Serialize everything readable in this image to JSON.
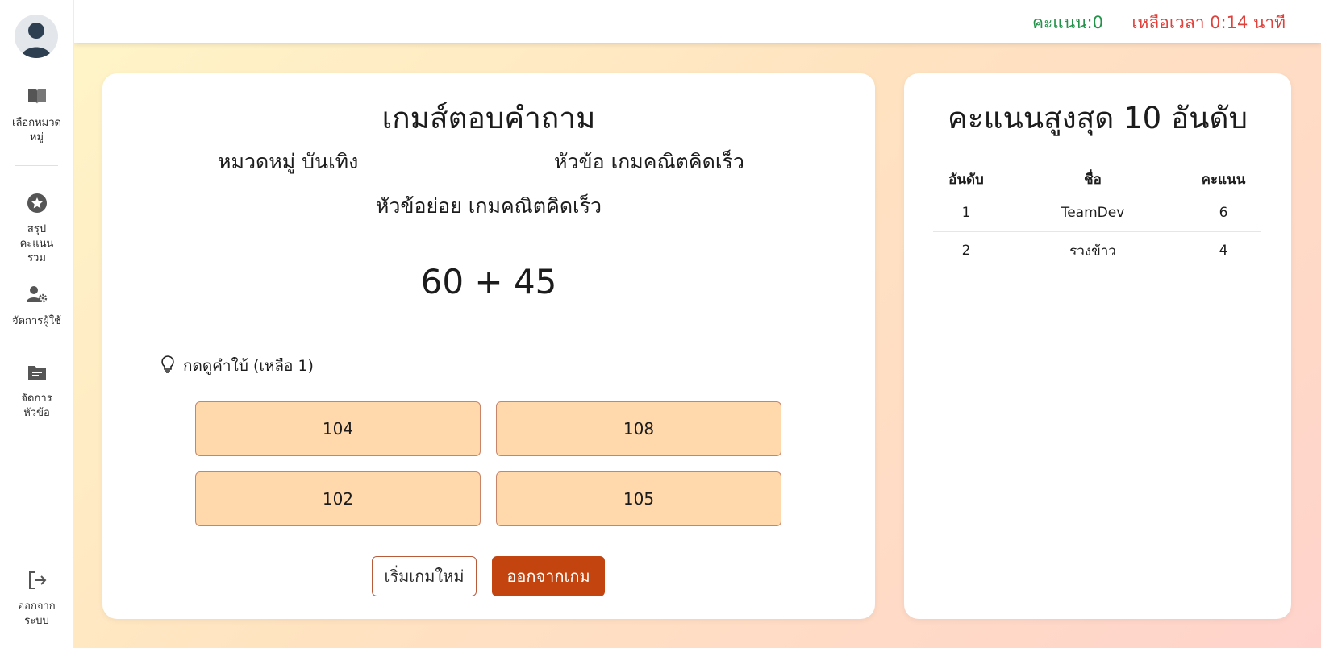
{
  "sidebar": {
    "items": [
      {
        "label": "เลือกหมวดหมู่",
        "icon": "book-icon"
      },
      {
        "label": "สรุปคะแนนรวม",
        "icon": "star-badge-icon"
      },
      {
        "label": "จัดการผู้ใช้",
        "icon": "user-settings-icon"
      },
      {
        "label": "จัดการหัวข้อ",
        "icon": "folder-icon"
      }
    ],
    "logout": {
      "label": "ออกจากระบบ",
      "icon": "logout-icon"
    }
  },
  "topbar": {
    "score": "คะแนน:0",
    "timer": "เหลือเวลา 0:14 นาที"
  },
  "game": {
    "title": "เกมส์ตอบคำถาม",
    "category": "หมวดหมู่ บันเทิง",
    "topic": "หัวข้อ เกมคณิตคิดเร็ว",
    "subtopic": "หัวข้อย่อย เกมคณิตคิดเร็ว",
    "question": "60 + 45",
    "hint": "กดดูคำใบ้ (เหลือ 1)",
    "answers": [
      "104",
      "108",
      "102",
      "105"
    ],
    "restart_label": "เริ่มเกมใหม่",
    "exit_label": "ออกจากเกม"
  },
  "leaderboard": {
    "title": "คะแนนสูงสุด 10 อันดับ",
    "columns": [
      "อันดับ",
      "ชื่อ",
      "คะแนน"
    ],
    "rows": [
      [
        "1",
        "TeamDev",
        "6"
      ],
      [
        "2",
        "รวงข้าว",
        "4"
      ]
    ]
  },
  "colors": {
    "accent": "#c3440f",
    "answer_bg": "#ffd8ab",
    "score_green": "#23934a",
    "timer_red": "#e1413a"
  }
}
